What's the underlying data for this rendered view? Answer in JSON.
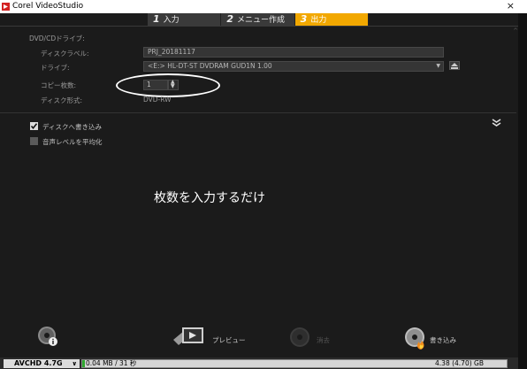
{
  "window": {
    "title": "Corel VideoStudio",
    "close_glyph": "×"
  },
  "steps": [
    {
      "num": "1",
      "label": "入力"
    },
    {
      "num": "2",
      "label": "メニュー作成"
    },
    {
      "num": "3",
      "label": "出力"
    }
  ],
  "side_mark": "^",
  "settings": {
    "section_label": "DVD/CDドライブ:",
    "disc_label_label": "ディスクラベル:",
    "disc_label_value": "PRJ_20181117",
    "drive_label": "ドライブ:",
    "drive_value": "<E:>  HL-DT-ST DVDRAM GUD1N 1.00",
    "copies_label": "コピー枚数:",
    "copies_value": "1",
    "disc_format_label": "ディスク形式:",
    "disc_format_value": "DVD-RW"
  },
  "options": {
    "write_to_disc": {
      "label": "ディスクへ書き込み",
      "checked": true
    },
    "equalize_audio": {
      "label": "音声レベルを平均化",
      "checked": false
    },
    "expand_glyph": "»"
  },
  "annotation": "枚数を入力するだけ",
  "actions": {
    "preview_label": "プレビュー",
    "erase_label": "消去",
    "burn_label": "書き込み"
  },
  "statusbar": {
    "format": "AVCHD 4.7G",
    "format_arrow": "∨",
    "used": "0.04 MB / 31 秒",
    "capacity": "4.38 (4.70) GB",
    "used_fraction": 0.005
  },
  "colors": {
    "accent": "#f2a800",
    "capacity_fill": "#2ea82e"
  }
}
